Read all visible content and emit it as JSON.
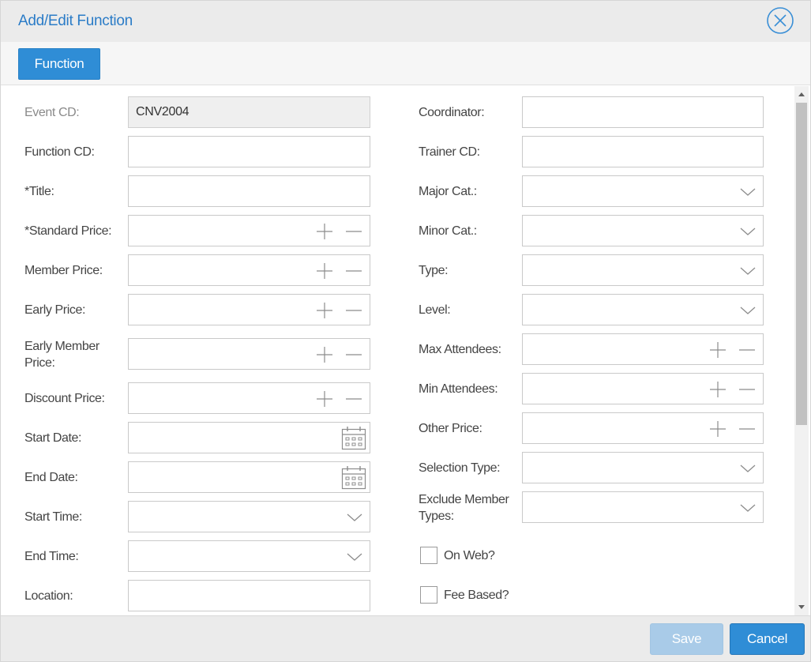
{
  "dialog": {
    "title": "Add/Edit Function",
    "close_icon": "circle-x-icon"
  },
  "tabs": [
    {
      "label": "Function"
    }
  ],
  "form_left": [
    {
      "label": "Event CD:",
      "type": "readonly",
      "value": "CNV2004"
    },
    {
      "label": "Function CD:",
      "type": "text",
      "value": ""
    },
    {
      "label": "*Title:",
      "type": "text",
      "value": ""
    },
    {
      "label": "*Standard Price:",
      "type": "numeric",
      "value": ""
    },
    {
      "label": "Member Price:",
      "type": "numeric",
      "value": ""
    },
    {
      "label": "Early Price:",
      "type": "numeric",
      "value": ""
    },
    {
      "label": "Early Member Price:",
      "type": "numeric",
      "value": ""
    },
    {
      "label": "Discount Price:",
      "type": "numeric",
      "value": ""
    },
    {
      "label": "Start Date:",
      "type": "date",
      "value": ""
    },
    {
      "label": "End Date:",
      "type": "date",
      "value": ""
    },
    {
      "label": "Start Time:",
      "type": "dropdown",
      "value": ""
    },
    {
      "label": "End Time:",
      "type": "dropdown",
      "value": ""
    },
    {
      "label": "Location:",
      "type": "text",
      "value": ""
    }
  ],
  "form_right": [
    {
      "label": "Coordinator:",
      "type": "text",
      "value": ""
    },
    {
      "label": "Trainer CD:",
      "type": "text",
      "value": ""
    },
    {
      "label": "Major Cat.:",
      "type": "dropdown",
      "value": ""
    },
    {
      "label": "Minor Cat.:",
      "type": "dropdown",
      "value": ""
    },
    {
      "label": "Type:",
      "type": "dropdown",
      "value": ""
    },
    {
      "label": "Level:",
      "type": "dropdown",
      "value": ""
    },
    {
      "label": "Max Attendees:",
      "type": "numeric",
      "value": ""
    },
    {
      "label": "Min Attendees:",
      "type": "numeric",
      "value": ""
    },
    {
      "label": "Other Price:",
      "type": "numeric",
      "value": ""
    },
    {
      "label": "Selection Type:",
      "type": "dropdown",
      "value": ""
    },
    {
      "label": "Exclude Member Types:",
      "type": "dropdown",
      "value": ""
    }
  ],
  "checkboxes": [
    {
      "label": "On Web?",
      "checked": false
    },
    {
      "label": "Fee Based?",
      "checked": false
    }
  ],
  "footer": {
    "save_label": "Save",
    "cancel_label": "Cancel"
  },
  "colors": {
    "accent": "#2f8dd6",
    "title": "#2b7cc7",
    "disabled_button": "#a9cbe8"
  },
  "icons": {
    "increment": "plus-icon",
    "decrement": "minus-icon",
    "dropdown": "chevron-down-icon",
    "calendar": "calendar-icon"
  }
}
